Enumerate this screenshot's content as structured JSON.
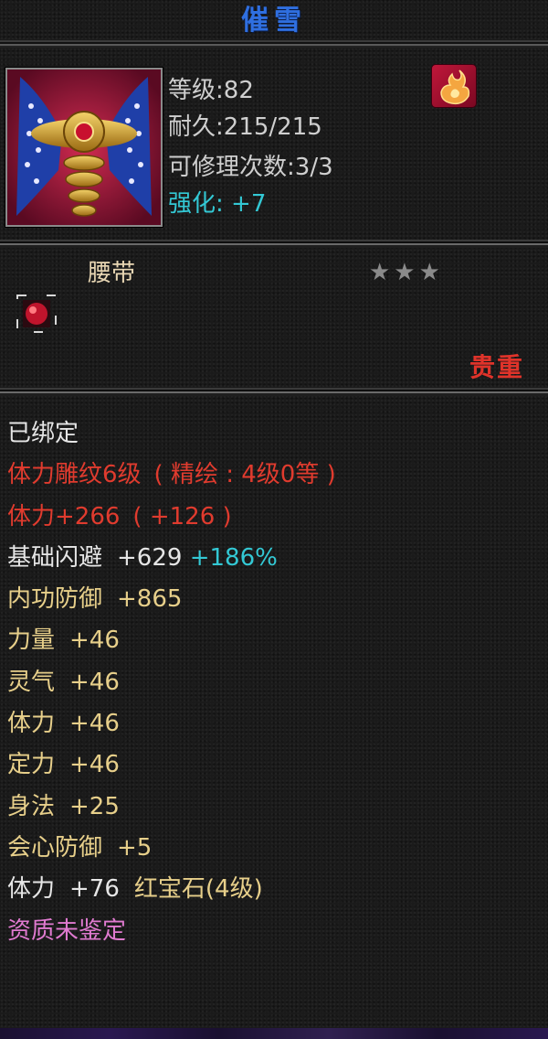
{
  "title": "催雪",
  "item": {
    "level_label": "等级",
    "level_value": ":82",
    "durability_label": "耐久",
    "durability_value": ":215/215",
    "repair_label": "可修理次数",
    "repair_value": ":3/3",
    "enhance_label": "强化:",
    "enhance_value": "+7",
    "type": "腰带",
    "stars": "★★★",
    "rarity": "贵重"
  },
  "attributes": {
    "bound": "已绑定",
    "carve": {
      "name": "体力雕纹6级",
      "detail": "( 精绘 : 4级0等 )"
    },
    "stamina_main": {
      "name": "体力+266",
      "detail": "( +126 )"
    },
    "dodge": {
      "name": "基础闪避",
      "value": "+629",
      "bonus": "+186%"
    },
    "inner_defense": {
      "name": "内功防御",
      "value": "+865"
    },
    "strength": {
      "name": "力量",
      "value": "+46"
    },
    "spirit": {
      "name": "灵气",
      "value": "+46"
    },
    "stamina": {
      "name": "体力",
      "value": "+46"
    },
    "focus": {
      "name": "定力",
      "value": "+46"
    },
    "agility": {
      "name": "身法",
      "value": "+25"
    },
    "crit_defense": {
      "name": "会心防御",
      "value": "+5"
    },
    "gem": {
      "name": "体力",
      "value": "+76",
      "gem": "红宝石(4级)"
    },
    "quality": "资质未鉴定"
  },
  "colors": {
    "title": "#2f6fe0",
    "enhance": "#33c8d4",
    "red_attr": "#e03b2e",
    "gold_attr": "#e7cf8a",
    "pink": "#e07ad0"
  },
  "icons": [
    "belt-item-icon",
    "fire-element-icon",
    "gem-slot-icon"
  ]
}
